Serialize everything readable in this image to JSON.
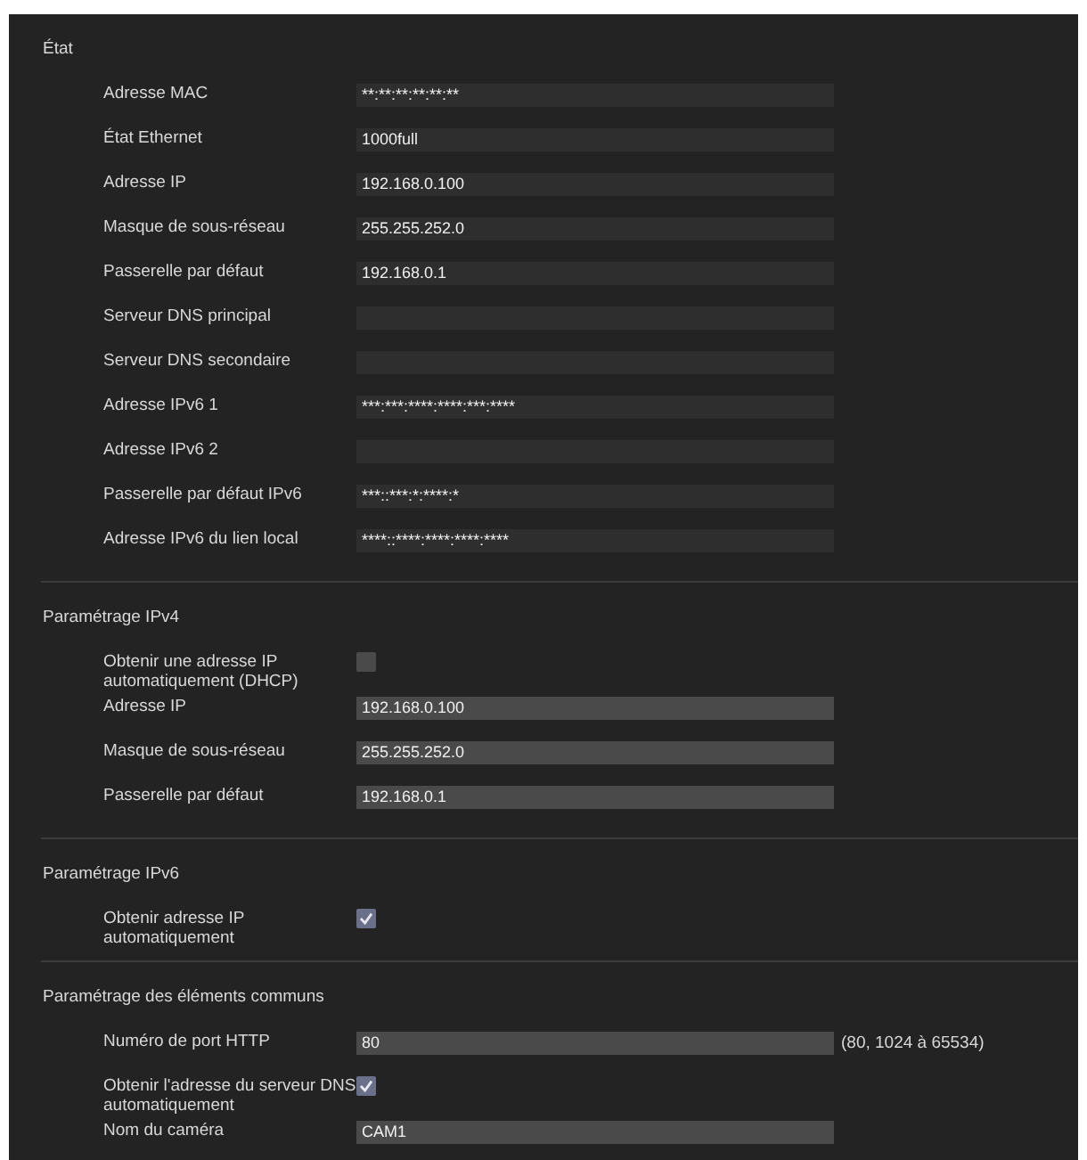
{
  "sections": [
    {
      "title": "État",
      "rows": [
        {
          "kind": "readonly",
          "label": "Adresse MAC",
          "value": "**:**:**:**:**:**"
        },
        {
          "kind": "readonly",
          "label": "État Ethernet",
          "value": "1000full"
        },
        {
          "kind": "readonly",
          "label": "Adresse IP",
          "value": "192.168.0.100"
        },
        {
          "kind": "readonly",
          "label": "Masque de sous-réseau",
          "value": "255.255.252.0"
        },
        {
          "kind": "readonly",
          "label": "Passerelle par défaut",
          "value": "192.168.0.1"
        },
        {
          "kind": "readonly",
          "label": "Serveur DNS principal",
          "value": ""
        },
        {
          "kind": "readonly",
          "label": "Serveur DNS secondaire",
          "value": ""
        },
        {
          "kind": "readonly",
          "label": "Adresse IPv6 1",
          "value": "***:***:****:****:***:****"
        },
        {
          "kind": "readonly",
          "label": "Adresse IPv6 2",
          "value": ""
        },
        {
          "kind": "readonly",
          "label": "Passerelle par défaut IPv6",
          "value": "***::***:*:****:*"
        },
        {
          "kind": "readonly",
          "label": "Adresse IPv6 du lien local",
          "value": "****::****:****:****:****"
        }
      ]
    },
    {
      "title": "Paramétrage IPv4",
      "rows": [
        {
          "kind": "checkbox",
          "label": "Obtenir une adresse IP automatiquement (DHCP)",
          "checked": false
        },
        {
          "kind": "input",
          "label": "Adresse IP",
          "value": "192.168.0.100"
        },
        {
          "kind": "input",
          "label": "Masque de sous-réseau",
          "value": "255.255.252.0"
        },
        {
          "kind": "input",
          "label": "Passerelle par défaut",
          "value": "192.168.0.1"
        }
      ]
    },
    {
      "title": "Paramétrage IPv6",
      "rows": [
        {
          "kind": "checkbox",
          "label": "Obtenir adresse IP automatiquement",
          "checked": true
        }
      ]
    },
    {
      "title": "Paramétrage des éléments communs",
      "rows": [
        {
          "kind": "input",
          "label": "Numéro de port HTTP",
          "value": "80",
          "note": "(80, 1024 à 65534)"
        },
        {
          "kind": "checkbox",
          "label": "Obtenir l'adresse du serveur DNS automatiquement",
          "checked": true
        },
        {
          "kind": "input",
          "label": "Nom du caméra",
          "value": "CAM1"
        }
      ]
    }
  ]
}
